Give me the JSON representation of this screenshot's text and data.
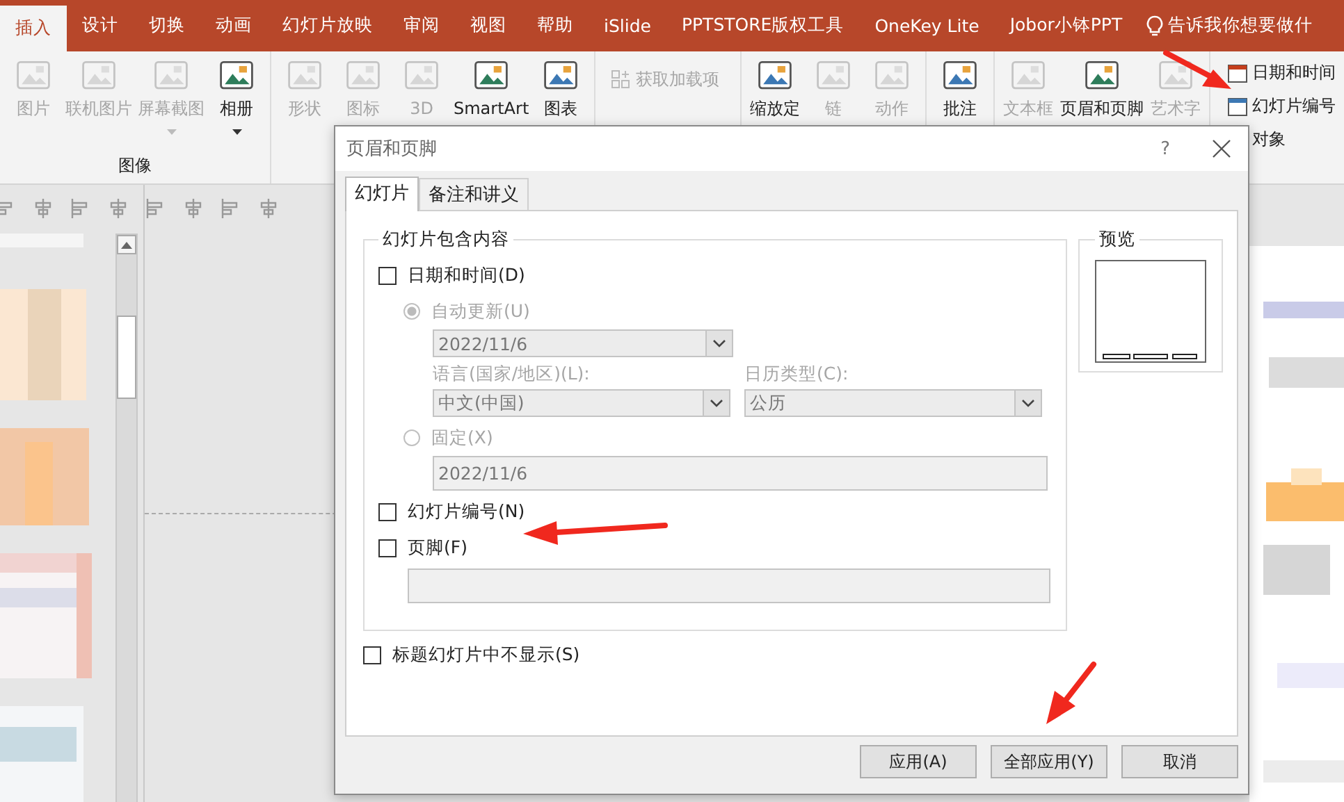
{
  "ribbon": {
    "tabs": [
      {
        "label": "插入",
        "selected": true
      },
      {
        "label": "设计",
        "selected": false
      },
      {
        "label": "切换",
        "selected": false
      },
      {
        "label": "动画",
        "selected": false
      },
      {
        "label": "幻灯片放映",
        "selected": false
      },
      {
        "label": "审阅",
        "selected": false
      },
      {
        "label": "视图",
        "selected": false
      },
      {
        "label": "帮助",
        "selected": false
      },
      {
        "label": "iSlide",
        "selected": false
      },
      {
        "label": "PPTSTORE版权工具",
        "selected": false
      },
      {
        "label": "OneKey Lite",
        "selected": false
      },
      {
        "label": "Jobor小钵PPT",
        "selected": false
      }
    ],
    "tell_me": "告诉我你想要做什",
    "groups": [
      {
        "label": "图像",
        "items": [
          {
            "kind": "large",
            "label": "图片",
            "disabled": true,
            "dropdown": false
          },
          {
            "kind": "large",
            "label": "联机图片",
            "disabled": true,
            "dropdown": false
          },
          {
            "kind": "large",
            "label": "屏幕截图",
            "disabled": true,
            "dropdown": true
          },
          {
            "kind": "large",
            "label": "相册",
            "disabled": false,
            "dropdown": true
          }
        ]
      },
      {
        "items": [
          {
            "kind": "large",
            "label": "形状",
            "disabled": true
          },
          {
            "kind": "large",
            "label": "图标",
            "disabled": true
          },
          {
            "kind": "large",
            "label": "3D",
            "disabled": true
          },
          {
            "kind": "large",
            "label": "SmartArt",
            "disabled": false
          },
          {
            "kind": "large",
            "label": "图表",
            "disabled": false
          }
        ]
      },
      {
        "items": [
          {
            "kind": "small",
            "label": "获取加载项",
            "disabled": true
          }
        ]
      },
      {
        "items": [
          {
            "kind": "large",
            "label": "缩放定",
            "disabled": false
          },
          {
            "kind": "large",
            "label": "链",
            "disabled": true
          },
          {
            "kind": "large",
            "label": "动作",
            "disabled": true
          }
        ]
      },
      {
        "items": [
          {
            "kind": "large",
            "label": "批注",
            "disabled": false
          }
        ]
      },
      {
        "items": [
          {
            "kind": "large",
            "label": "文本框",
            "disabled": true
          },
          {
            "kind": "large",
            "label": "页眉和页脚",
            "disabled": false
          },
          {
            "kind": "large",
            "label": "艺术字",
            "disabled": true
          }
        ]
      }
    ],
    "side_items": [
      {
        "label": "日期和时间"
      },
      {
        "label": "幻灯片编号"
      },
      {
        "label": "对象"
      }
    ]
  },
  "dialog": {
    "title": "页眉和页脚",
    "help": "?",
    "tabs": [
      {
        "label": "幻灯片",
        "selected": true
      },
      {
        "label": "备注和讲义",
        "selected": false
      }
    ],
    "include_group": {
      "title": "幻灯片包含内容",
      "date_time": {
        "label": "日期和时间(D)",
        "checked": false
      },
      "auto_update": {
        "label": "自动更新(U)",
        "selected": true,
        "disabled": true
      },
      "date_format": {
        "value": "2022/11/6",
        "disabled": true
      },
      "language": {
        "label": "语言(国家/地区)(L):",
        "value": "中文(中国)",
        "disabled": true
      },
      "calendar": {
        "label": "日历类型(C):",
        "value": "公历",
        "disabled": true
      },
      "fixed": {
        "label": "固定(X)",
        "selected": false,
        "disabled": true
      },
      "fixed_value": {
        "value": "2022/11/6",
        "disabled": true
      },
      "slide_number": {
        "label": "幻灯片编号(N)",
        "checked": false
      },
      "footer": {
        "label": "页脚(F)",
        "checked": false,
        "disabled": true
      }
    },
    "hide_on_title": {
      "label": "标题幻灯片中不显示(S)",
      "checked": false
    },
    "preview": {
      "title": "预览"
    },
    "buttons": [
      {
        "label": "应用(A)"
      },
      {
        "label": "全部应用(Y)"
      },
      {
        "label": "取消"
      }
    ]
  }
}
